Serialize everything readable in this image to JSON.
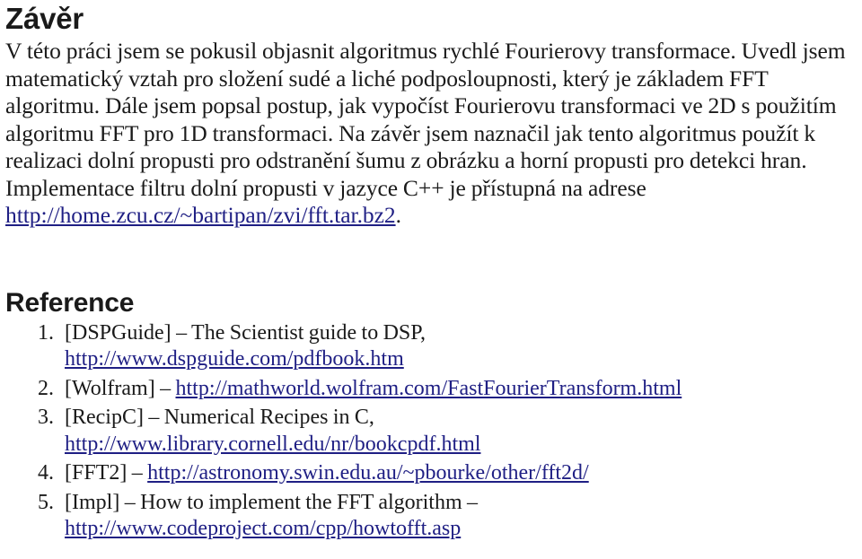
{
  "document": {
    "background_color": "#ffffff",
    "text_color": "#1a1a1a",
    "link_color": "#1f1f84"
  },
  "conclusion": {
    "heading": "Závěr",
    "paragraph": {
      "part1": "V této práci jsem se pokusil objasnit algoritmus rychlé Fourierovy transformace. Uvedl jsem matematický vztah pro složení sudé a liché podposloupnosti, který je základem FFT algoritmu. Dále jsem popsal postup, jak vypočíst Fourierovu transformaci ve 2D s použitím algoritmu FFT pro 1D transformaci. Na závěr jsem naznačil jak tento algoritmus použít k realizaci dolní propusti pro odstranění šumu z obrázku a horní propusti pro detekci hran. Implementace filtru dolní propusti v jazyce C++ je přístupná na adrese ",
      "link_text": "http://home.zcu.cz/~bartipan/zvi/fft.tar.bz2",
      "part2": "."
    }
  },
  "references": {
    "heading": "Reference",
    "items": [
      {
        "number": "1.",
        "text": "[DSPGuide] – The Scientist guide to DSP,",
        "link": "http://www.dspguide.com/pdfbook.htm",
        "link_on_new_line": true
      },
      {
        "number": "2.",
        "text": "[Wolfram] – ",
        "link": "http://mathworld.wolfram.com/FastFourierTransform.html",
        "link_on_new_line": false
      },
      {
        "number": "3.",
        "text": "[RecipC] – Numerical Recipes in C,",
        "link": "http://www.library.cornell.edu/nr/bookcpdf.html",
        "link_on_new_line": true
      },
      {
        "number": "4.",
        "text": "[FFT2] – ",
        "link": "http://astronomy.swin.edu.au/~pbourke/other/fft2d/",
        "link_on_new_line": false
      },
      {
        "number": "5.",
        "text": "[Impl] – How to implement the FFT algorithm –",
        "link": "http://www.codeproject.com/cpp/howtofft.asp",
        "link_on_new_line": true
      }
    ]
  }
}
